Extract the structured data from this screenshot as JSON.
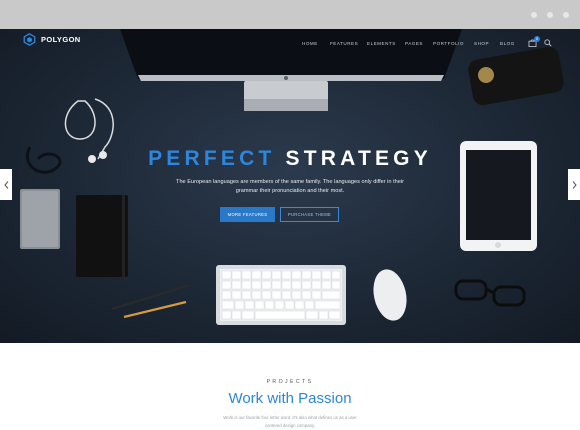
{
  "nav": {
    "brand": "POLYGON",
    "menu": [
      "HOME",
      "FEATURES",
      "ELEMENTS",
      "PAGES",
      "PORTFOLIO",
      "SHOP",
      "BLOG"
    ],
    "cart_count": "0"
  },
  "hero": {
    "title_highlight": "PERFECT",
    "title_rest": "STRATEGY",
    "subtitle": "The European languages are members of the same family. The languages only differ in their grammar their pronunciation and their most.",
    "primary_button": "MORE FEATURES",
    "secondary_button": "PURCHASE THEME"
  },
  "projects": {
    "label": "PROJECTS",
    "title": "Work with Passion",
    "description": "Work is our favorite four letter word. It's also what defines us as a user centered design company."
  },
  "colors": {
    "accent": "#2d86de",
    "hero_bg": "#1d2836",
    "browser_bar": "#c9c9c9"
  }
}
